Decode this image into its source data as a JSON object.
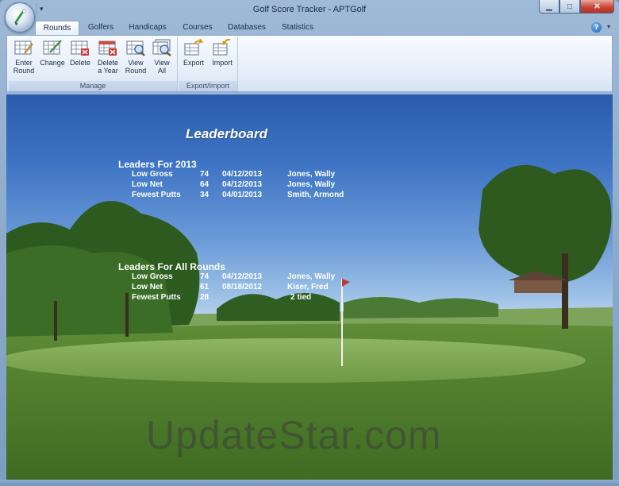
{
  "window": {
    "title": "Golf Score Tracker - APTGolf",
    "buttons": {
      "minimize": "▁",
      "maximize": "□",
      "close": "✕"
    }
  },
  "tabs": [
    {
      "label": "Rounds",
      "active": true
    },
    {
      "label": "Golfers",
      "active": false
    },
    {
      "label": "Handicaps",
      "active": false
    },
    {
      "label": "Courses",
      "active": false
    },
    {
      "label": "Databases",
      "active": false
    },
    {
      "label": "Statistics",
      "active": false
    }
  ],
  "ribbon": {
    "manage": {
      "label": "Manage",
      "buttons": [
        {
          "line1": "Enter",
          "line2": "Round",
          "icon": "enter-round-icon"
        },
        {
          "line1": "Change",
          "line2": "",
          "icon": "change-icon"
        },
        {
          "line1": "Delete",
          "line2": "",
          "icon": "delete-icon"
        },
        {
          "line1": "Delete",
          "line2": "a Year",
          "icon": "delete-year-icon"
        },
        {
          "line1": "View",
          "line2": "Round",
          "icon": "view-round-icon"
        },
        {
          "line1": "View",
          "line2": "All",
          "icon": "view-all-icon"
        }
      ]
    },
    "export_import": {
      "label": "Export/Import",
      "buttons": [
        {
          "line1": "Export",
          "line2": "",
          "icon": "export-icon"
        },
        {
          "line1": "Import",
          "line2": "",
          "icon": "import-icon"
        }
      ]
    }
  },
  "leaderboard": {
    "title": "Leaderboard",
    "sections": [
      {
        "title": "Leaders For 2013",
        "rows": [
          {
            "category": "Low Gross",
            "value": "74",
            "date": "04/12/2013",
            "name": "Jones, Wally"
          },
          {
            "category": "Low Net",
            "value": "64",
            "date": "04/12/2013",
            "name": "Jones, Wally"
          },
          {
            "category": "Fewest Putts",
            "value": "34",
            "date": "04/01/2013",
            "name": "Smith, Armond"
          }
        ]
      },
      {
        "title": "Leaders For All Rounds",
        "rows": [
          {
            "category": "Low Gross",
            "value": "74",
            "date": "04/12/2013",
            "name": "Jones, Wally"
          },
          {
            "category": "Low Net",
            "value": "61",
            "date": "08/18/2012",
            "name": "Kiser, Fred"
          },
          {
            "category": "Fewest Putts",
            "value": "28",
            "date": "",
            "name": "2 tied"
          }
        ]
      }
    ]
  },
  "watermark": "UpdateStar.com"
}
